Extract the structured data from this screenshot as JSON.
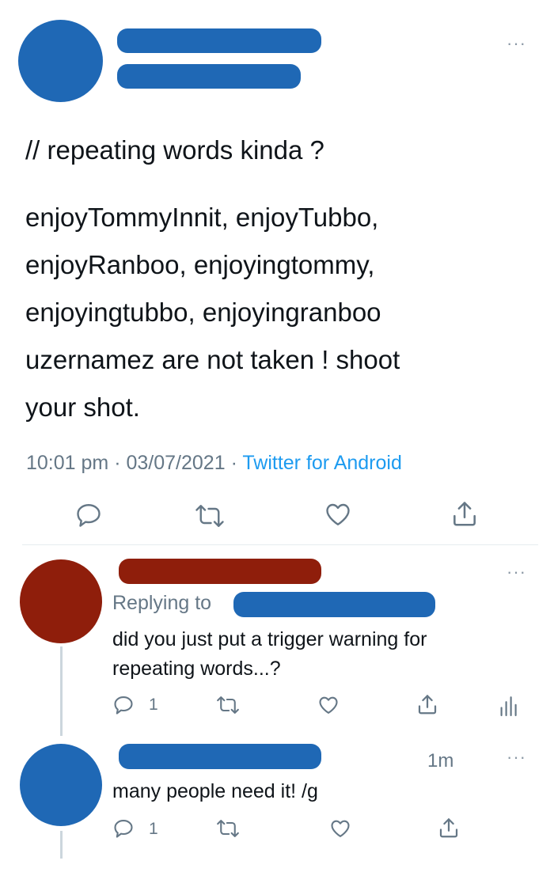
{
  "colors": {
    "redacted_blue": "#1f68b5",
    "redacted_red": "#8f1e0b",
    "muted": "#657786",
    "link": "#1d9bf0",
    "text": "#0f1419",
    "divider": "#e6ecf0"
  },
  "main_tweet": {
    "more_label": "···",
    "cw_line": "// repeating words kinda ?",
    "body_lines": [
      "enjoyTommyInnit, enjoyTubbo,",
      "enjoyRanboo, enjoyingtommy,",
      "enjoyingtubbo, enjoyingranboo",
      "uzernamez are not taken ! shoot",
      "your shot."
    ],
    "time": "10:01 pm",
    "sep1": "·",
    "date": "03/07/2021",
    "sep2": "·",
    "source": "Twitter for Android",
    "actions": [
      "reply-icon",
      "retweet-icon",
      "like-icon",
      "share-icon"
    ]
  },
  "reply_1": {
    "more_label": "···",
    "replying_to": "Replying to",
    "text_lines": [
      "did you just put a trigger warning for",
      "repeating words...?"
    ],
    "reply_count": "1",
    "actions": [
      "reply-icon",
      "retweet-icon",
      "like-icon",
      "share-icon",
      "analytics-icon"
    ]
  },
  "reply_2": {
    "more_label": "···",
    "timestamp": "1m",
    "text": "many people need it! /g",
    "reply_count": "1",
    "actions": [
      "reply-icon",
      "retweet-icon",
      "like-icon",
      "share-icon"
    ]
  }
}
